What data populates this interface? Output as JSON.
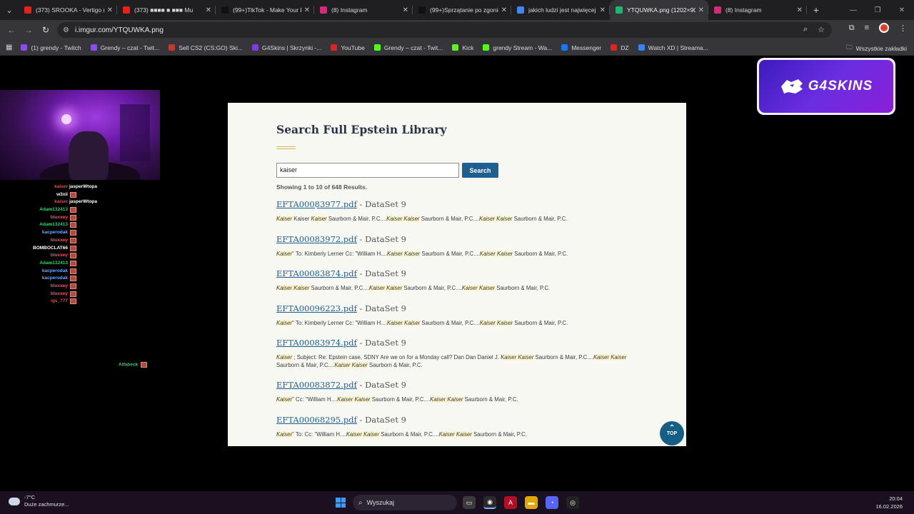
{
  "browser": {
    "tabs": [
      {
        "title": "(373) SROOKA - Vertigo (...",
        "icon": "youtube-icon",
        "color": "#e62117"
      },
      {
        "title": "(373) ■■■■ ■ ■■■ Mu",
        "icon": "youtube-icon",
        "color": "#e62117"
      },
      {
        "title": "(99+)TikTok - Make Your Da",
        "icon": "tiktok-icon",
        "color": "#111111"
      },
      {
        "title": "(8) Instagram",
        "icon": "instagram-icon",
        "color": "#d62976"
      },
      {
        "title": "(99+)Sprzątanie po zgonie",
        "icon": "tiktok-icon",
        "color": "#111111"
      },
      {
        "title": "jakich ludzi jest najwięcej",
        "icon": "google-icon",
        "color": "#4285f4"
      },
      {
        "title": "YTQUWKA.png (1202×90",
        "icon": "imgur-icon",
        "color": "#1bb76e"
      },
      {
        "title": "(8) Instagram",
        "icon": "instagram-icon",
        "color": "#d62976"
      }
    ],
    "active_tab": 6,
    "url": "i.imgur.com/YTQUWKA.png",
    "bookmarks": [
      {
        "label": "(1) grendy - Twitch",
        "color": "#9146ff"
      },
      {
        "label": "Grendy – czat - Twit...",
        "color": "#9146ff"
      },
      {
        "label": "Sell CS2 (CS:GO) Ski...",
        "color": "#c0392b"
      },
      {
        "label": "G4Skins | Skrzynki -...",
        "color": "#7c3aed"
      },
      {
        "label": "YouTube",
        "color": "#e62117"
      },
      {
        "label": "Grendy – czat - Twit...",
        "color": "#53fc18"
      },
      {
        "label": "Kick",
        "color": "#53fc18"
      },
      {
        "label": "grendy Stream - Wa...",
        "color": "#53fc18"
      },
      {
        "label": "Messenger",
        "color": "#1877f2"
      },
      {
        "label": "DZ",
        "color": "#e62117"
      },
      {
        "label": "Watch XD | Streama...",
        "color": "#3b82f6"
      }
    ],
    "all_bookmarks": "Wszystkie zakładki"
  },
  "overlay": {
    "chat": [
      {
        "name": "kaiser",
        "color": "#e24b4b",
        "msg": "jasperWtopa"
      },
      {
        "name": "w3xii",
        "color": "#ffffff",
        "msg": ""
      },
      {
        "name": "kaiser",
        "color": "#e24b4b",
        "msg": "jasperWtopa"
      },
      {
        "name": "Adam132413",
        "color": "#2ecc71",
        "msg": ""
      },
      {
        "name": "bluxxey",
        "color": "#ff4d6d",
        "msg": ""
      },
      {
        "name": "Adam132413",
        "color": "#2ecc71",
        "msg": ""
      },
      {
        "name": "kacperodak",
        "color": "#6fa8ff",
        "msg": ""
      },
      {
        "name": "bluxxey",
        "color": "#ff4d6d",
        "msg": ""
      },
      {
        "name": "BOMBOCLAT66",
        "color": "#ffffff",
        "msg": ""
      },
      {
        "name": "bluxxey",
        "color": "#ff4d6d",
        "msg": ""
      },
      {
        "name": "Adam132413",
        "color": "#2ecc71",
        "msg": ""
      },
      {
        "name": "kacperodak",
        "color": "#6fa8ff",
        "msg": ""
      },
      {
        "name": "kacperodak",
        "color": "#6fa8ff",
        "msg": ""
      },
      {
        "name": "bluxxey",
        "color": "#ff4d6d",
        "msg": ""
      },
      {
        "name": "bluxxey",
        "color": "#ff4d6d",
        "msg": ""
      },
      {
        "name": "igs_777",
        "color": "#e24b4b",
        "msg": ""
      }
    ],
    "alfa_name": "Alfabeck",
    "logo_text": "G4SKINS"
  },
  "document": {
    "title": "Search Full Epstein Library",
    "search_value": "kaiser",
    "search_button": "Search",
    "showing": "Showing 1 to 10 of 648 Results.",
    "results": [
      {
        "file": "EFTA00083977.pdf",
        "dataset": " - DataSet 9",
        "snippet": [
          [
            "Kaiser",
            1
          ],
          [
            " Kaiser ",
            0
          ],
          [
            "Kaiser",
            1
          ],
          [
            " Saurborn & Mair, P.C....",
            0
          ],
          [
            "Kaiser Kaiser",
            1
          ],
          [
            " Saurborn & Mair, P.C....",
            0
          ],
          [
            "Kaiser Kaiser",
            1
          ],
          [
            " Saurborn & Mair, P.C.",
            0
          ]
        ]
      },
      {
        "file": "EFTA00083972.pdf",
        "dataset": " - DataSet 9",
        "snippet": [
          [
            "Kaiser",
            1
          ],
          [
            "\" To: Kimberly Lerner Cc: \"William H....",
            0
          ],
          [
            "Kaiser Kaiser",
            1
          ],
          [
            " Saurborn & Mair, P.C....",
            0
          ],
          [
            "Kaiser Kaiser",
            1
          ],
          [
            " Saurborn & Mair, P.C.",
            0
          ]
        ]
      },
      {
        "file": "EFTA00083874.pdf",
        "dataset": " - DataSet 9",
        "snippet": [
          [
            "Kaiser Kaiser",
            1
          ],
          [
            " Saurborn & Mair, P.C....",
            0
          ],
          [
            "Kaiser Kaiser",
            1
          ],
          [
            " Saurborn & Mair, P.C....",
            0
          ],
          [
            "Kaiser Kaiser",
            1
          ],
          [
            " Saurborn & Mair, P.C.",
            0
          ]
        ]
      },
      {
        "file": "EFTA00096223.pdf",
        "dataset": " - DataSet 9",
        "snippet": [
          [
            "Kaiser",
            1
          ],
          [
            "\" To: Kimberly Lerner Cc: \"William H....",
            0
          ],
          [
            "Kaiser Kaiser",
            1
          ],
          [
            " Saurborn & Mair, P.C....",
            0
          ],
          [
            "Kaiser Kaiser",
            1
          ],
          [
            " Saurborn & Mair, P.C.",
            0
          ]
        ]
      },
      {
        "file": "EFTA00083974.pdf",
        "dataset": " - DataSet 9",
        "snippet": [
          [
            "Kaiser",
            1
          ],
          [
            " ; Subject: Re: Epstein case, SDNY Are we on for a Monday call? Dan Dan Daniel J. ",
            0
          ],
          [
            "Kaiser Kaiser",
            1
          ],
          [
            " Saurborn & Mair, P.C....",
            0
          ],
          [
            "Kaiser Kaiser",
            1
          ],
          [
            " Saurborn & Mair, P.C....",
            0
          ],
          [
            "Kaiser Kaiser",
            1
          ],
          [
            " Saurborn & Mair, P.C.",
            0
          ]
        ]
      },
      {
        "file": "EFTA00083872.pdf",
        "dataset": " - DataSet 9",
        "snippet": [
          [
            "Kaiser",
            1
          ],
          [
            "\" Cc: \"William H....",
            0
          ],
          [
            "Kaiser Kaiser",
            1
          ],
          [
            " Saurborn & Mair, P.C....",
            0
          ],
          [
            "Kaiser Kaiser",
            1
          ],
          [
            " Saurborn & Mair, P.C.",
            0
          ]
        ]
      },
      {
        "file": "EFTA00068295.pdf",
        "dataset": " - DataSet 9",
        "snippet": [
          [
            "Kaiser",
            1
          ],
          [
            "\" To: Cc: \"William H....",
            0
          ],
          [
            "Kaiser Kaiser",
            1
          ],
          [
            " Saurborn & Mair, P.C....",
            0
          ],
          [
            "Kaiser Kaiser",
            1
          ],
          [
            " Saurborn & Mair, P.C.",
            0
          ]
        ]
      }
    ],
    "top_label": "TOP"
  },
  "taskbar": {
    "temp": "-7°C",
    "weather": "Duże zachmurze...",
    "search_label": "Wyszukaj",
    "time": "20:04",
    "date": "16.02.2026"
  }
}
